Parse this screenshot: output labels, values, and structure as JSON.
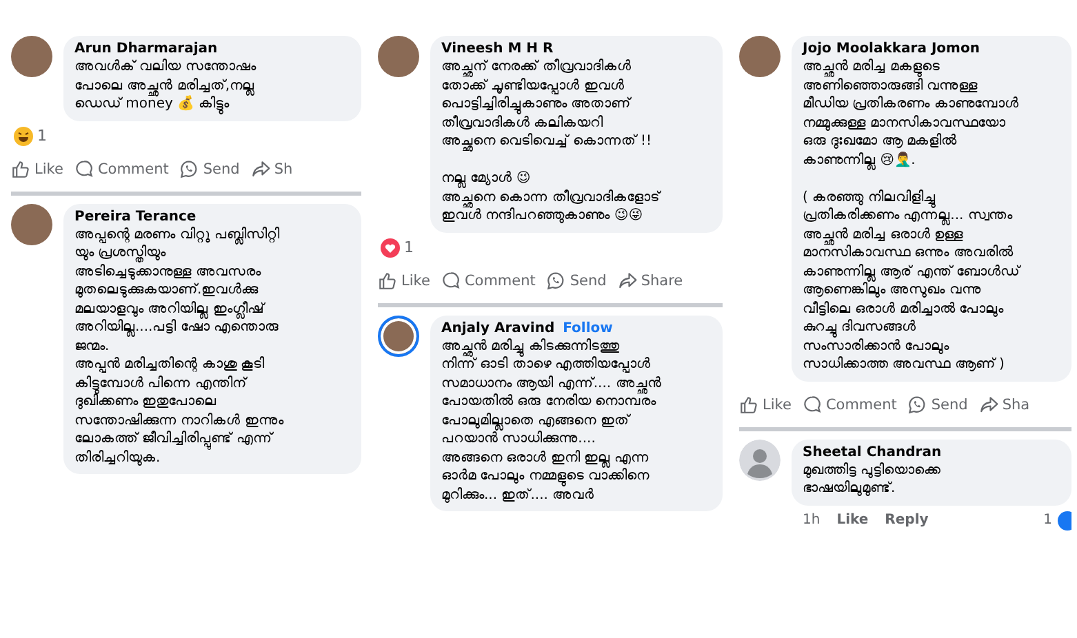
{
  "columns": [
    {
      "blocks": [
        {
          "kind": "comment",
          "author": "Arun Dharmarajan",
          "avatar": {
            "kind": "photo"
          },
          "story_ring": false,
          "text": "അവൾക് വലിയ സന്തോഷം\nപോലെ അച്ഛൻ മരിച്ചത്,നല്ല\nഡെഡ് money 💰 കിട്ടും"
        },
        {
          "kind": "reaction",
          "emoji": {
            "kind": "haha"
          },
          "count": "1"
        },
        {
          "kind": "actions",
          "items": [
            {
              "kind": "like",
              "label": "Like"
            },
            {
              "kind": "comment",
              "label": "Comment"
            },
            {
              "kind": "send",
              "label": "Send"
            },
            {
              "kind": "share",
              "label": "Sh"
            }
          ]
        },
        {
          "kind": "divider"
        },
        {
          "kind": "comment",
          "author": "Pereira Terance",
          "avatar": {
            "kind": "photo"
          },
          "story_ring": false,
          "text": "അപ്പന്റെ മരണം വിറ്റു പബ്ലിസിറ്റി\nയും പ്രശസ്തിയും\nഅടിച്ചെടുക്കാനുള്ള അവസരം\nമുതലെടുക്കുകയാണ്.ഇവൾക്കു\nമലയാളവും അറിയില്ല ഇംഗ്ലീഷ്\nഅറിയില്ല....പട്ടി ഷോ എന്തൊരു\nജന്മം.\n അപ്പൻ മരിച്ചതിന്റെ കാശു കൂടി\nകിട്ടുമ്പോൾ പിന്നെ എന്തിന്\nദുഖിക്കണം ഇതുപോലെ\nസന്തോഷിക്കുന്ന നാറികൾ ഇന്നും\nലോകത്ത് ജീവിച്ചിരിപ്പുണ്ട് എന്ന്\nതിരിച്ചറിയുക."
        }
      ]
    },
    {
      "blocks": [
        {
          "kind": "comment",
          "author": "Vineesh M H R",
          "avatar": {
            "kind": "photo"
          },
          "story_ring": false,
          "text": "അച്ഛന് നേരക്ക്  തീവ്രവാദികൾ\nതോക്ക് ചൂണ്ടിയപ്പോൾ ഇവൾ\nപൊട്ടിച്ചിരിച്ചുകാണും  അതാണ്\nതീവ്രവാദികൾ  കലികയറി\nഅച്ഛനെ വെടിവെച്ച് കൊന്നത് !!\n\nനല്ല മ്യോൾ 😉\nഅച്ഛനെ കൊന്ന തീവ്രവാദികളോട്\nഇവൾ നന്ദിപറഞ്ഞുകാണും 😉😜"
        },
        {
          "kind": "reaction",
          "emoji": {
            "kind": "love"
          },
          "count": "1"
        },
        {
          "kind": "actions",
          "items": [
            {
              "kind": "like",
              "label": "Like"
            },
            {
              "kind": "comment",
              "label": "Comment"
            },
            {
              "kind": "send",
              "label": "Send"
            },
            {
              "kind": "share",
              "label": "Share"
            }
          ]
        },
        {
          "kind": "divider"
        },
        {
          "kind": "comment",
          "author": "Anjaly Aravind",
          "follow": "Follow",
          "avatar": {
            "kind": "photo"
          },
          "story_ring": true,
          "text": "അച്ഛൻ മരിച്ചു കിടക്കുന്നിടത്തു\nനിന്ന് ഓടി താഴെ എത്തിയപ്പോൾ\nസമാധാനം ആയി എന്ന്.... അച്ഛൻ\nപോയതിൽ ഒരു നേരിയ നൊമ്പരം\nപോലുമില്ലാതെ എങ്ങനെ ഇത്\nപറയാൻ സാധിക്കുന്നു....\nഅങ്ങനെ ഒരാൾ ഇനി ഇല്ല എന്ന\nഓർമ പോലും നമ്മളുടെ വാക്കിനെ\nമുറിക്കും... ഇത്.... അവർ"
        }
      ]
    },
    {
      "blocks": [
        {
          "kind": "comment",
          "author": "Jojo Moolakkara Jomon",
          "avatar": {
            "kind": "photo"
          },
          "story_ring": false,
          "text": "അച്ഛൻ മരിച്ച മകളുടെ\nഅണിഞ്ഞൊരുങ്ങി വന്നുള്ള\nമീഡിയ പ്രതികരണം കാണുമ്പോൾ\nനമ്മുക്കുള്ള മാനസികാവസ്ഥയോ\nഒരു  ദുഃഖമോ ആ മകളിൽ\nകാണുന്നില്ല 😢🤦‍♂️.\n\n( കരഞ്ഞു നിലവിളിച്ചു\nപ്രതികരിക്കണം എന്നല്ല... സ്വന്തം\nഅച്ഛൻ മരിച്ച ഒരാൾ ഉള്ള\nമാനസികാവസ്ഥ ഒന്നും അവരിൽ\nകാണുന്നില്ല ആര് എന്ത് ബോൾഡ്\nആണെങ്കിലും അസുഖം വന്നു\nവീട്ടിലെ ഒരാൾ മരിച്ചാൽ പോലും\nകുറച്ചു ദിവസങ്ങൾ\nസംസാരിക്കാൻ പോലും\nസാധിക്കാത്ത അവസ്ഥ ആണ് )"
        },
        {
          "kind": "actions",
          "items": [
            {
              "kind": "like",
              "label": "Like"
            },
            {
              "kind": "comment",
              "label": "Comment"
            },
            {
              "kind": "send",
              "label": "Send"
            },
            {
              "kind": "share",
              "label": "Sha"
            }
          ]
        },
        {
          "kind": "divider"
        },
        {
          "kind": "comment",
          "author": "Sheetal Chandran",
          "avatar": {
            "kind": "default"
          },
          "story_ring": false,
          "text": "മുഖത്തിട്ട പുട്ടിയൊക്കെ\nഭാഷയിലുമുണ്ട്."
        },
        {
          "kind": "meta",
          "time": "1h",
          "links": [
            "Like",
            "Reply"
          ],
          "count": "1"
        }
      ]
    }
  ]
}
